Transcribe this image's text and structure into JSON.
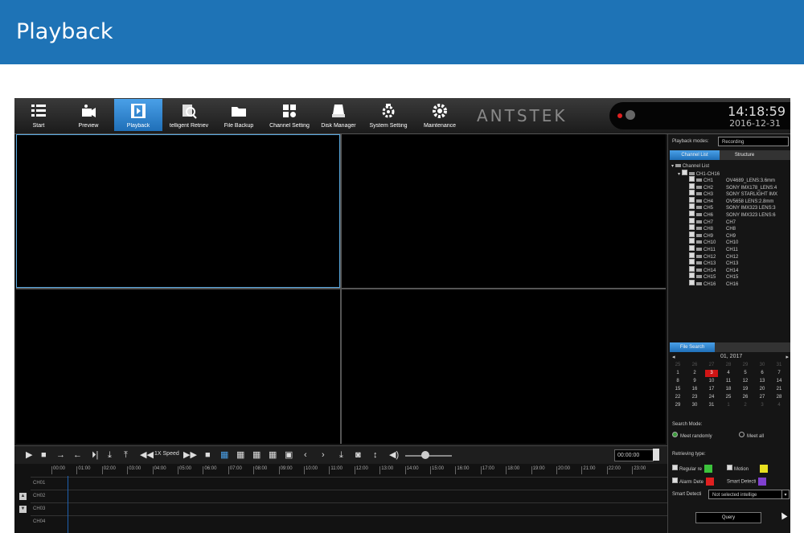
{
  "banner": {
    "title": "Playback"
  },
  "toolbar": {
    "items": [
      {
        "label": "Start",
        "icon": "list-icon"
      },
      {
        "label": "Preview",
        "icon": "preview-camera-icon"
      },
      {
        "label": "Playback",
        "icon": "film-icon",
        "active": true
      },
      {
        "label": "telligent Retriev",
        "icon": "search-doc-icon"
      },
      {
        "label": "File Backup",
        "icon": "folder-icon"
      },
      {
        "label": "Channel Setting",
        "icon": "channel-grid-icon"
      },
      {
        "label": "Disk Manager",
        "icon": "disk-icon"
      },
      {
        "label": "System Setting",
        "icon": "gear-camera-icon"
      },
      {
        "label": "Maintenance",
        "icon": "gear-icon"
      }
    ],
    "logo": "ANTSTEK",
    "time": "14:18:59",
    "date": "2016-12-31"
  },
  "controls": {
    "speed": "1X Speed",
    "time_value": "00:00:00"
  },
  "timeline": {
    "hours": [
      "00:00",
      "01:00",
      "02:00",
      "03:00",
      "04:00",
      "05:00",
      "06:00",
      "07:00",
      "08:00",
      "09:00",
      "10:00",
      "11:00",
      "12:00",
      "13:00",
      "14:00",
      "15:00",
      "16:00",
      "17:00",
      "18:00",
      "19:00",
      "20:00",
      "21:00",
      "22:00",
      "23:00"
    ],
    "channels": [
      "CH01",
      "CH02",
      "CH03",
      "CH04"
    ]
  },
  "sidebar": {
    "playback_modes_label": "Playback modes:",
    "playback_mode_value": "Recording",
    "tabs": [
      "Channel List",
      "Structure"
    ],
    "tree_root": "Channel List",
    "tree_group": "CH1-CH16",
    "channels": [
      {
        "id": "CH1",
        "name": "OV4689_LENS:3.6mm"
      },
      {
        "id": "CH2",
        "name": "SONY IMX178_LENS:4"
      },
      {
        "id": "CH3",
        "name": "SONY STARLIGHT IMX"
      },
      {
        "id": "CH4",
        "name": "OV5658 LENS:2.8mm"
      },
      {
        "id": "CH5",
        "name": "SONY IMX323 LENS:3"
      },
      {
        "id": "CH6",
        "name": "SONY IMX323 LENS:6"
      },
      {
        "id": "CH7",
        "name": "CH7"
      },
      {
        "id": "CH8",
        "name": "CH8"
      },
      {
        "id": "CH9",
        "name": "CH9"
      },
      {
        "id": "CH10",
        "name": "CH10"
      },
      {
        "id": "CH11",
        "name": "CH11"
      },
      {
        "id": "CH12",
        "name": "CH12"
      },
      {
        "id": "CH13",
        "name": "CH13"
      },
      {
        "id": "CH14",
        "name": "CH14"
      },
      {
        "id": "CH15",
        "name": "CH15"
      },
      {
        "id": "CH16",
        "name": "CH16"
      }
    ],
    "file_search_tab": "File Search",
    "calendar_month": "01,  2017",
    "calendar_days": [
      [
        "25",
        "26",
        "27",
        "28",
        "29",
        "30",
        "31"
      ],
      [
        "1",
        "2",
        "3",
        "4",
        "5",
        "6",
        "7"
      ],
      [
        "8",
        "9",
        "10",
        "11",
        "12",
        "13",
        "14"
      ],
      [
        "15",
        "16",
        "17",
        "18",
        "19",
        "20",
        "21"
      ],
      [
        "22",
        "23",
        "24",
        "25",
        "26",
        "27",
        "28"
      ],
      [
        "29",
        "30",
        "31",
        "1",
        "2",
        "3",
        "4"
      ]
    ],
    "calendar_today": "3",
    "search_mode_label": "Search Mode:",
    "search_mode_options": [
      "Meet randomly",
      "Meet all"
    ],
    "retrieving_type_label": "Retrieving type:",
    "retrieving_types": [
      {
        "label": "Regular re",
        "color": "#3cc23c"
      },
      {
        "label": "Motion",
        "color": "#e8e020"
      },
      {
        "label": "Alarm Dete",
        "color": "#e02020"
      },
      {
        "label": "Smart Detecti",
        "color": "#8040d0"
      }
    ],
    "smart_detect_label": "Smart Detecti",
    "smart_detect_value": "Not selected intellige",
    "query_button": "Query"
  }
}
